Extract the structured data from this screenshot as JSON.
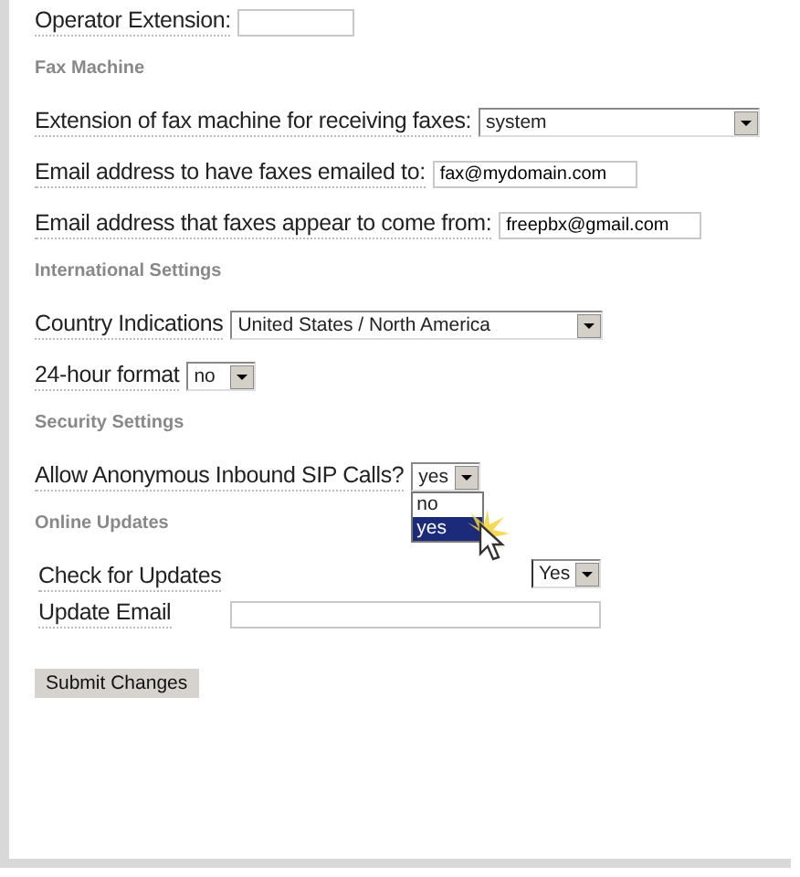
{
  "rows": [
    {
      "kind": "field",
      "label": "Operator Extension:"
    }
  ],
  "sections": [
    {
      "heading": "Fax Machine",
      "kind": "list",
      "rows": [
        {
          "kind": "select",
          "label": "Extension of fax machine for receiving faxes:",
          "value": "system"
        },
        {
          "kind": "field",
          "label": "Email address to have faxes emailed to:",
          "value": "fax@mydomain.com"
        },
        {
          "kind": "field",
          "label": "Email address that faxes appear to come from:",
          "value": "freepbx@gmail.com"
        }
      ]
    },
    {
      "heading": "International Settings",
      "kind": "list",
      "rows": [
        {
          "kind": "select",
          "label": "Country Indications",
          "value": "United States / North America"
        },
        {
          "kind": "select",
          "label": "24-hour format",
          "value": "no"
        }
      ]
    },
    {
      "heading": "Security Settings",
      "kind": "list",
      "rows": [
        {
          "kind": "select",
          "label": "Allow Anonymous Inbound SIP Calls?",
          "value": "yes",
          "expanded": true,
          "options": [
            {
              "label": "no",
              "selected": false
            },
            {
              "label": "yes",
              "selected": true
            }
          ]
        }
      ]
    },
    {
      "heading": "Online Updates",
      "kind": "table",
      "rows": [
        {
          "kind": "select",
          "label": "Check for Updates",
          "value": "Yes"
        },
        {
          "kind": "field",
          "label": "Update Email"
        }
      ]
    }
  ],
  "submit_button": "Submit Changes"
}
